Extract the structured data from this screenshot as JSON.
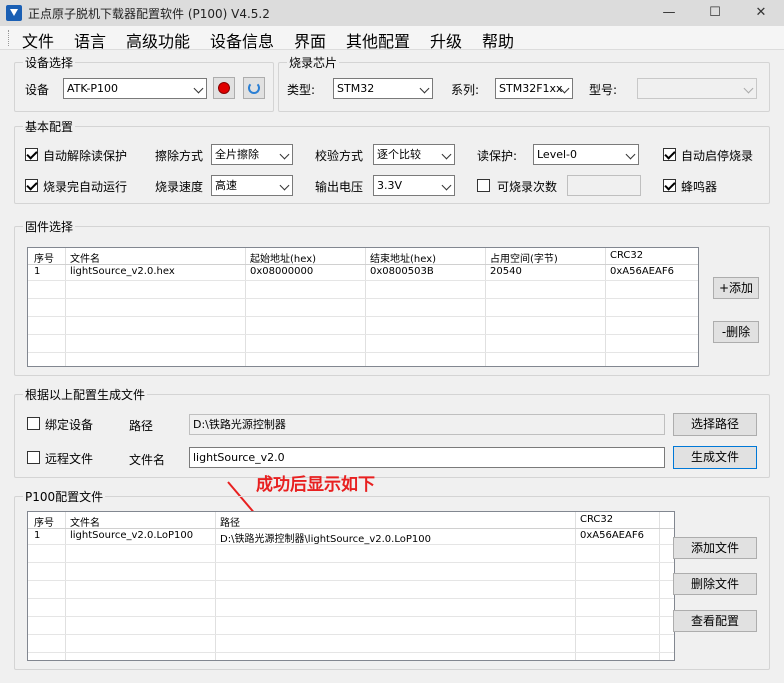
{
  "window": {
    "title": "正点原子脱机下载器配置软件 (P100)  V4.5.2",
    "minimize_glyph": "—",
    "maximize_glyph": "☐",
    "close_glyph": "✕"
  },
  "menu": [
    "文件",
    "语言",
    "高级功能",
    "设备信息",
    "界面",
    "其他配置",
    "升级",
    "帮助"
  ],
  "device_group": {
    "title": "设备选择",
    "label": "设备",
    "value": "ATK-P100"
  },
  "chip_group": {
    "title": "烧录芯片",
    "type_label": "类型:",
    "type_value": "STM32",
    "series_label": "系列:",
    "series_value": "STM32F1xx",
    "model_label": "型号:",
    "model_value": ""
  },
  "basic_group": {
    "title": "基本配置",
    "auto_unprotect": "自动解除读保护",
    "auto_run": "烧录完自动运行",
    "erase_label": "擦除方式",
    "erase_value": "全片擦除",
    "speed_label": "烧录速度",
    "speed_value": "高速",
    "verify_label": "校验方式",
    "verify_value": "逐个比较",
    "voltage_label": "输出电压",
    "voltage_value": "3.3V",
    "read_protect_label": "读保护:",
    "read_protect_value": "Level-0",
    "burn_count_label": "可烧录次数",
    "auto_start_stop": "自动启停烧录",
    "buzzer": "蜂鸣器"
  },
  "firmware_group": {
    "title": "固件选择",
    "headers": [
      "序号",
      "文件名",
      "起始地址(hex)",
      "结束地址(hex)",
      "占用空间(字节)",
      "CRC32"
    ],
    "rows": [
      [
        "1",
        "lightSource_v2.0.hex",
        "0x08000000",
        "0x0800503B",
        "20540",
        "0xA56AEAF6"
      ]
    ],
    "add_label": "+添加",
    "delete_label": "-删除"
  },
  "generate_group": {
    "title": "根据以上配置生成文件",
    "bind_device": "绑定设备",
    "path_label": "路径",
    "path_value": "D:\\铁路光源控制器",
    "choose_path": "选择路径",
    "remote_file": "远程文件",
    "filename_label": "文件名",
    "filename_value": "lightSource_v2.0",
    "generate": "生成文件"
  },
  "annotation": "成功后显示如下",
  "p100_group": {
    "title": "P100配置文件",
    "headers": [
      "序号",
      "文件名",
      "路径",
      "CRC32"
    ],
    "rows": [
      [
        "1",
        "lightSource_v2.0.LoP100",
        "D:\\铁路光源控制器\\lightSource_v2.0.LoP100",
        "0xA56AEAF6"
      ]
    ],
    "add_file": "添加文件",
    "delete_file": "删除文件",
    "view_config": "查看配置"
  },
  "colors": {
    "annotation_red": "#e82020",
    "record_red": "#e00000",
    "refresh_blue": "#2a7fd4"
  }
}
